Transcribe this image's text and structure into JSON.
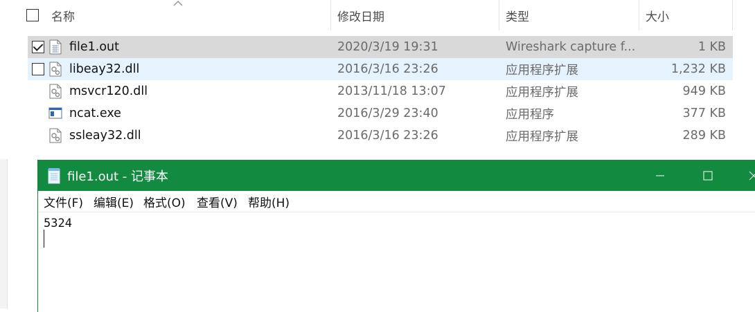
{
  "explorer": {
    "columns": {
      "name": "名称",
      "date": "修改日期",
      "type": "类型",
      "size": "大小"
    },
    "files": [
      {
        "name": "file1.out",
        "date": "2020/3/19 19:31",
        "type": "Wireshark capture f...",
        "size": "1 KB",
        "icon": "generic-file-icon",
        "checked": true,
        "state": "selected"
      },
      {
        "name": "libeay32.dll",
        "date": "2016/3/16 23:26",
        "type": "应用程序扩展",
        "size": "1,232 KB",
        "icon": "dll-icon",
        "checked": false,
        "state": "hover"
      },
      {
        "name": "msvcr120.dll",
        "date": "2013/11/18 13:07",
        "type": "应用程序扩展",
        "size": "949 KB",
        "icon": "dll-icon",
        "checked": null,
        "state": "normal"
      },
      {
        "name": "ncat.exe",
        "date": "2016/3/29 23:40",
        "type": "应用程序",
        "size": "377 KB",
        "icon": "exe-icon",
        "checked": null,
        "state": "normal"
      },
      {
        "name": "ssleay32.dll",
        "date": "2016/3/16 23:26",
        "type": "应用程序扩展",
        "size": "289 KB",
        "icon": "dll-icon",
        "checked": null,
        "state": "normal"
      }
    ]
  },
  "notepad": {
    "title": "file1.out - 记事本",
    "titlebar_color": "#128a3f",
    "menu": [
      "文件(F)",
      "编辑(E)",
      "格式(O)",
      "查看(V)",
      "帮助(H)"
    ],
    "content": "5324"
  }
}
